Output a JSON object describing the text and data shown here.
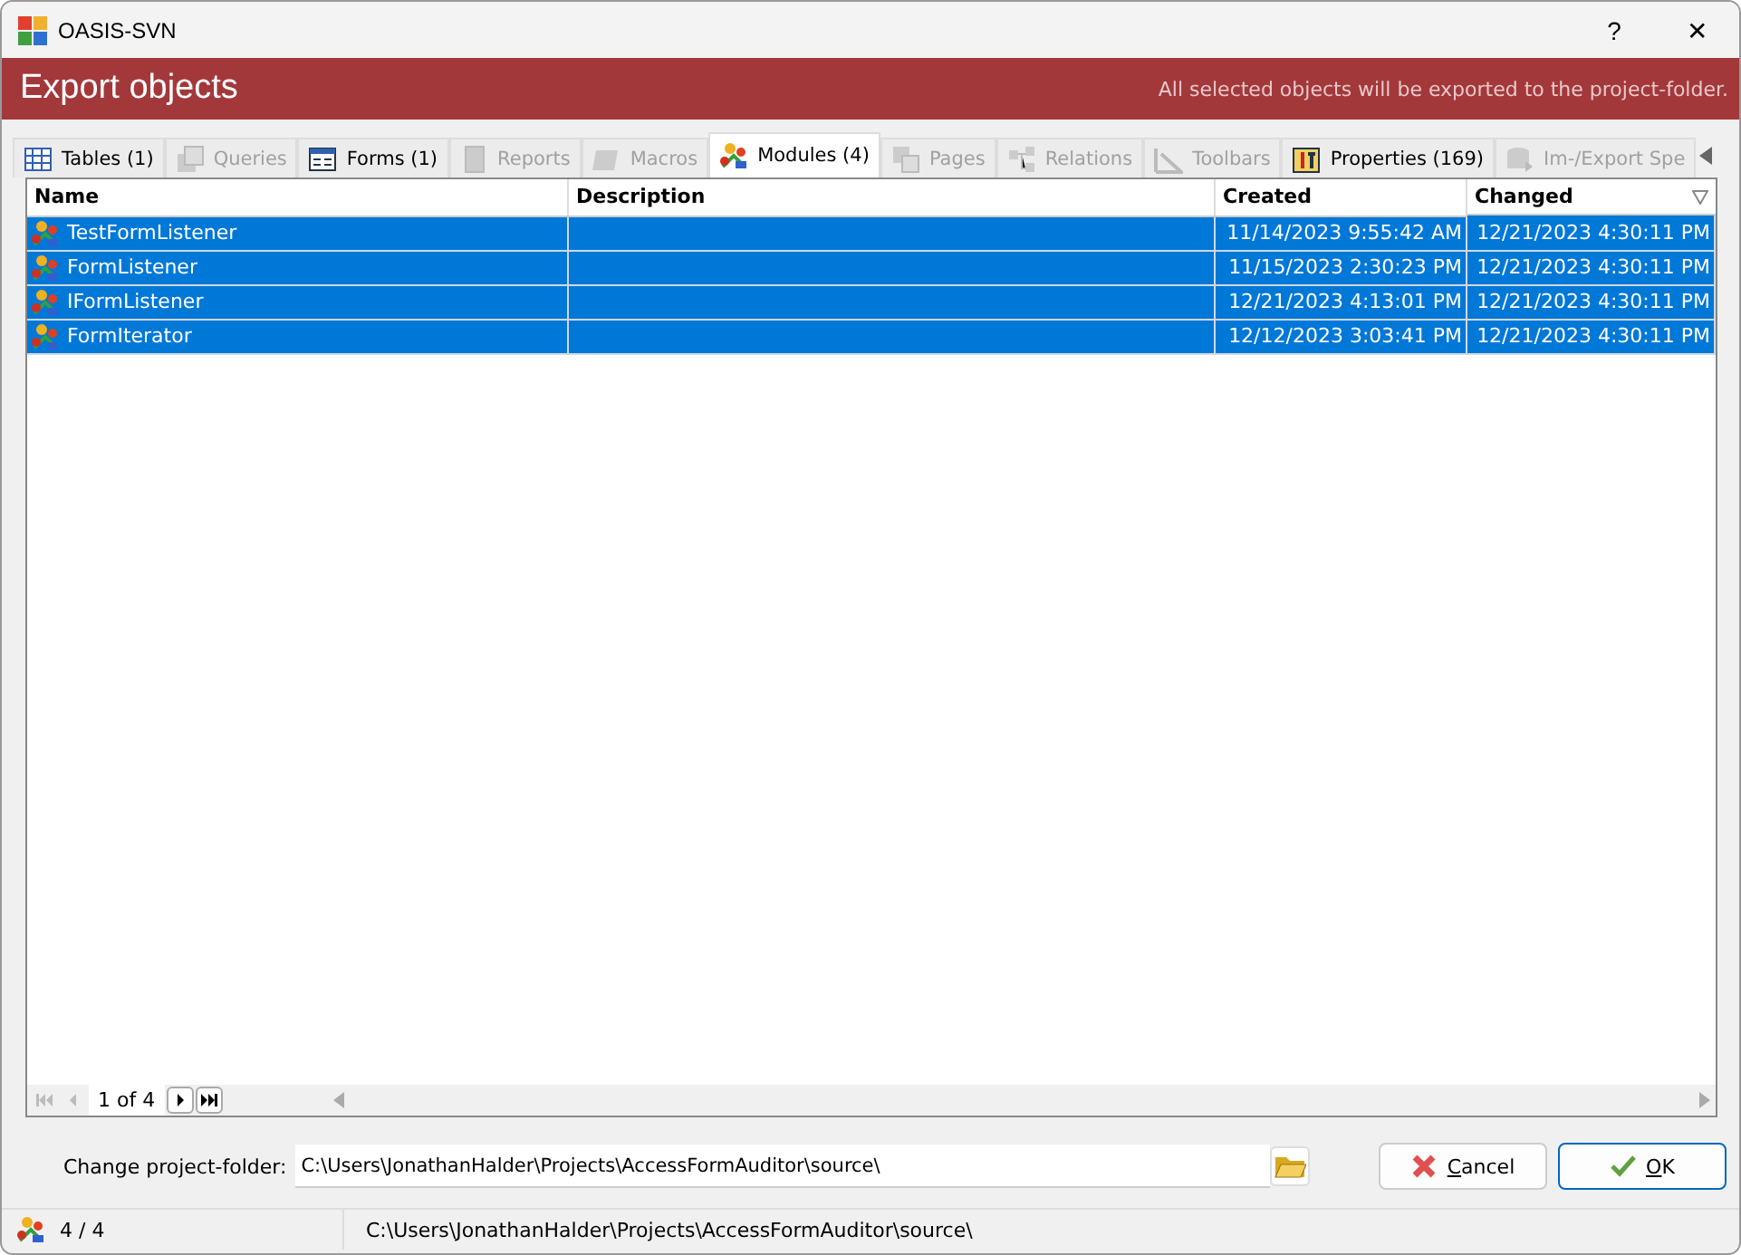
{
  "window": {
    "title": "OASIS-SVN",
    "help": "?",
    "close": "✕"
  },
  "header": {
    "title": "Export objects",
    "hint": "All selected objects will be exported to the project-folder."
  },
  "tabs": [
    {
      "label": "Tables (1)",
      "kind": "table",
      "disabled": false,
      "selected": false
    },
    {
      "label": "Queries",
      "kind": "query",
      "disabled": true,
      "selected": false
    },
    {
      "label": "Forms (1)",
      "kind": "form",
      "disabled": false,
      "selected": false
    },
    {
      "label": "Reports",
      "kind": "report",
      "disabled": true,
      "selected": false
    },
    {
      "label": "Macros",
      "kind": "macro",
      "disabled": true,
      "selected": false
    },
    {
      "label": "Modules (4)",
      "kind": "module",
      "disabled": false,
      "selected": true
    },
    {
      "label": "Pages",
      "kind": "page",
      "disabled": true,
      "selected": false
    },
    {
      "label": "Relations",
      "kind": "relation",
      "disabled": true,
      "selected": false
    },
    {
      "label": "Toolbars",
      "kind": "toolbar",
      "disabled": true,
      "selected": false
    },
    {
      "label": "Properties (169)",
      "kind": "property",
      "disabled": false,
      "selected": false
    },
    {
      "label": "Im-/Export Spe",
      "kind": "spec",
      "disabled": true,
      "selected": false
    }
  ],
  "table": {
    "columns": [
      "Name",
      "Description",
      "Created",
      "Changed"
    ],
    "rows": [
      {
        "name": "TestFormListener",
        "description": "",
        "created": "11/14/2023 9:55:42 AM",
        "changed": "12/21/2023 4:30:11 PM",
        "selected": true
      },
      {
        "name": "FormListener",
        "description": "",
        "created": "11/15/2023 2:30:23 PM",
        "changed": "12/21/2023 4:30:11 PM",
        "selected": true
      },
      {
        "name": "IFormListener",
        "description": "",
        "created": "12/21/2023 4:13:01 PM",
        "changed": "12/21/2023 4:30:11 PM",
        "selected": true
      },
      {
        "name": "FormIterator",
        "description": "",
        "created": "12/12/2023 3:03:41 PM",
        "changed": "12/21/2023 4:30:11 PM",
        "selected": true
      }
    ],
    "pager": "1 of 4"
  },
  "folder": {
    "label": "Change project-folder:",
    "value": "C:\\Users\\JonathanHalder\\Projects\\AccessFormAuditor\\source\\"
  },
  "buttons": [
    {
      "kind": "cancel",
      "label_parts": [
        "C",
        "ancel"
      ]
    },
    {
      "kind": "ok",
      "label_parts": [
        "O",
        "K"
      ]
    }
  ],
  "status_bar": {
    "count": "4 / 4",
    "path": "C:\\Users\\JonathanHalder\\Projects\\AccessFormAuditor\\source\\"
  }
}
